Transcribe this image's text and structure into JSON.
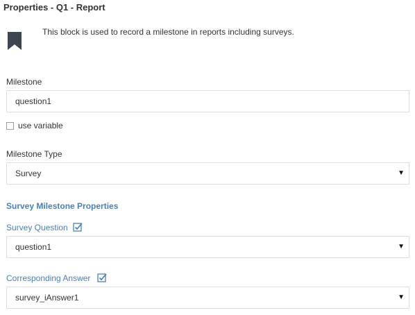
{
  "panel": {
    "title": "Properties - Q1 - Report",
    "description": "This block is used to record a milestone in reports including surveys."
  },
  "milestone": {
    "label": "Milestone",
    "value": "question1",
    "use_variable_label": "use variable",
    "use_variable_checked": false
  },
  "milestone_type": {
    "label": "Milestone Type",
    "selected": "Survey"
  },
  "survey_section": {
    "title": "Survey Milestone Properties",
    "question_label": "Survey Question",
    "question_checked": true,
    "question_selected": "question1",
    "answer_label": "Corresponding Answer",
    "answer_checked": true,
    "answer_selected": "survey_iAnswer1"
  },
  "icons": {
    "block": "bookmark-icon",
    "dropdown": "caret-down-icon",
    "checked": "checked-box-icon"
  },
  "colors": {
    "accent": "#4a7fb5",
    "icon_dark": "#3b4651"
  }
}
